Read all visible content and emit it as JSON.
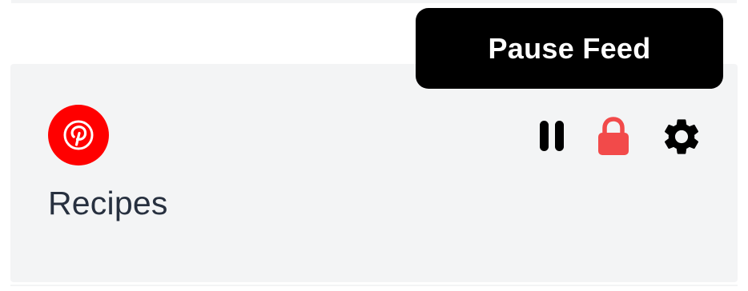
{
  "feed": {
    "title": "Recipes",
    "source_icon": "pinterest-icon",
    "source_color": "#ff0000"
  },
  "tooltip": {
    "text": "Pause Feed"
  },
  "controls": {
    "pause_icon": "pause-icon",
    "lock_icon": "lock-icon",
    "settings_icon": "gear-icon",
    "lock_color": "#f24a4a"
  }
}
